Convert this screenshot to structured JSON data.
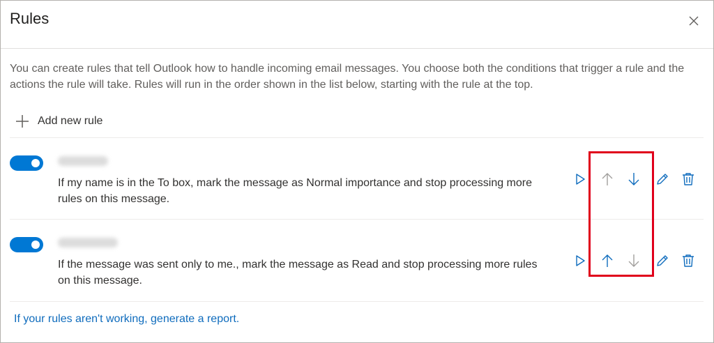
{
  "dialog": {
    "title": "Rules",
    "description": "You can create rules that tell Outlook how to handle incoming email messages. You choose both the conditions that trigger a rule and the actions the rule will take. Rules will run in the order shown in the list below, starting with the rule at the top.",
    "add_rule_label": "Add new rule",
    "report_link": "If your rules aren't working, generate a report."
  },
  "rules": [
    {
      "enabled": true,
      "description": "If my name is in the To box, mark the message as Normal importance and stop processing more rules on this message."
    },
    {
      "enabled": true,
      "description": "If the message was sent only to me., mark the message as Read and stop processing more rules on this message."
    }
  ],
  "colors": {
    "accent": "#0078d4",
    "link": "#0f6cbd",
    "highlight_box": "#e0001b"
  },
  "icons": [
    "close-icon",
    "plus-icon",
    "run-icon",
    "arrow-up-icon",
    "arrow-down-icon",
    "pencil-icon",
    "trash-icon"
  ]
}
